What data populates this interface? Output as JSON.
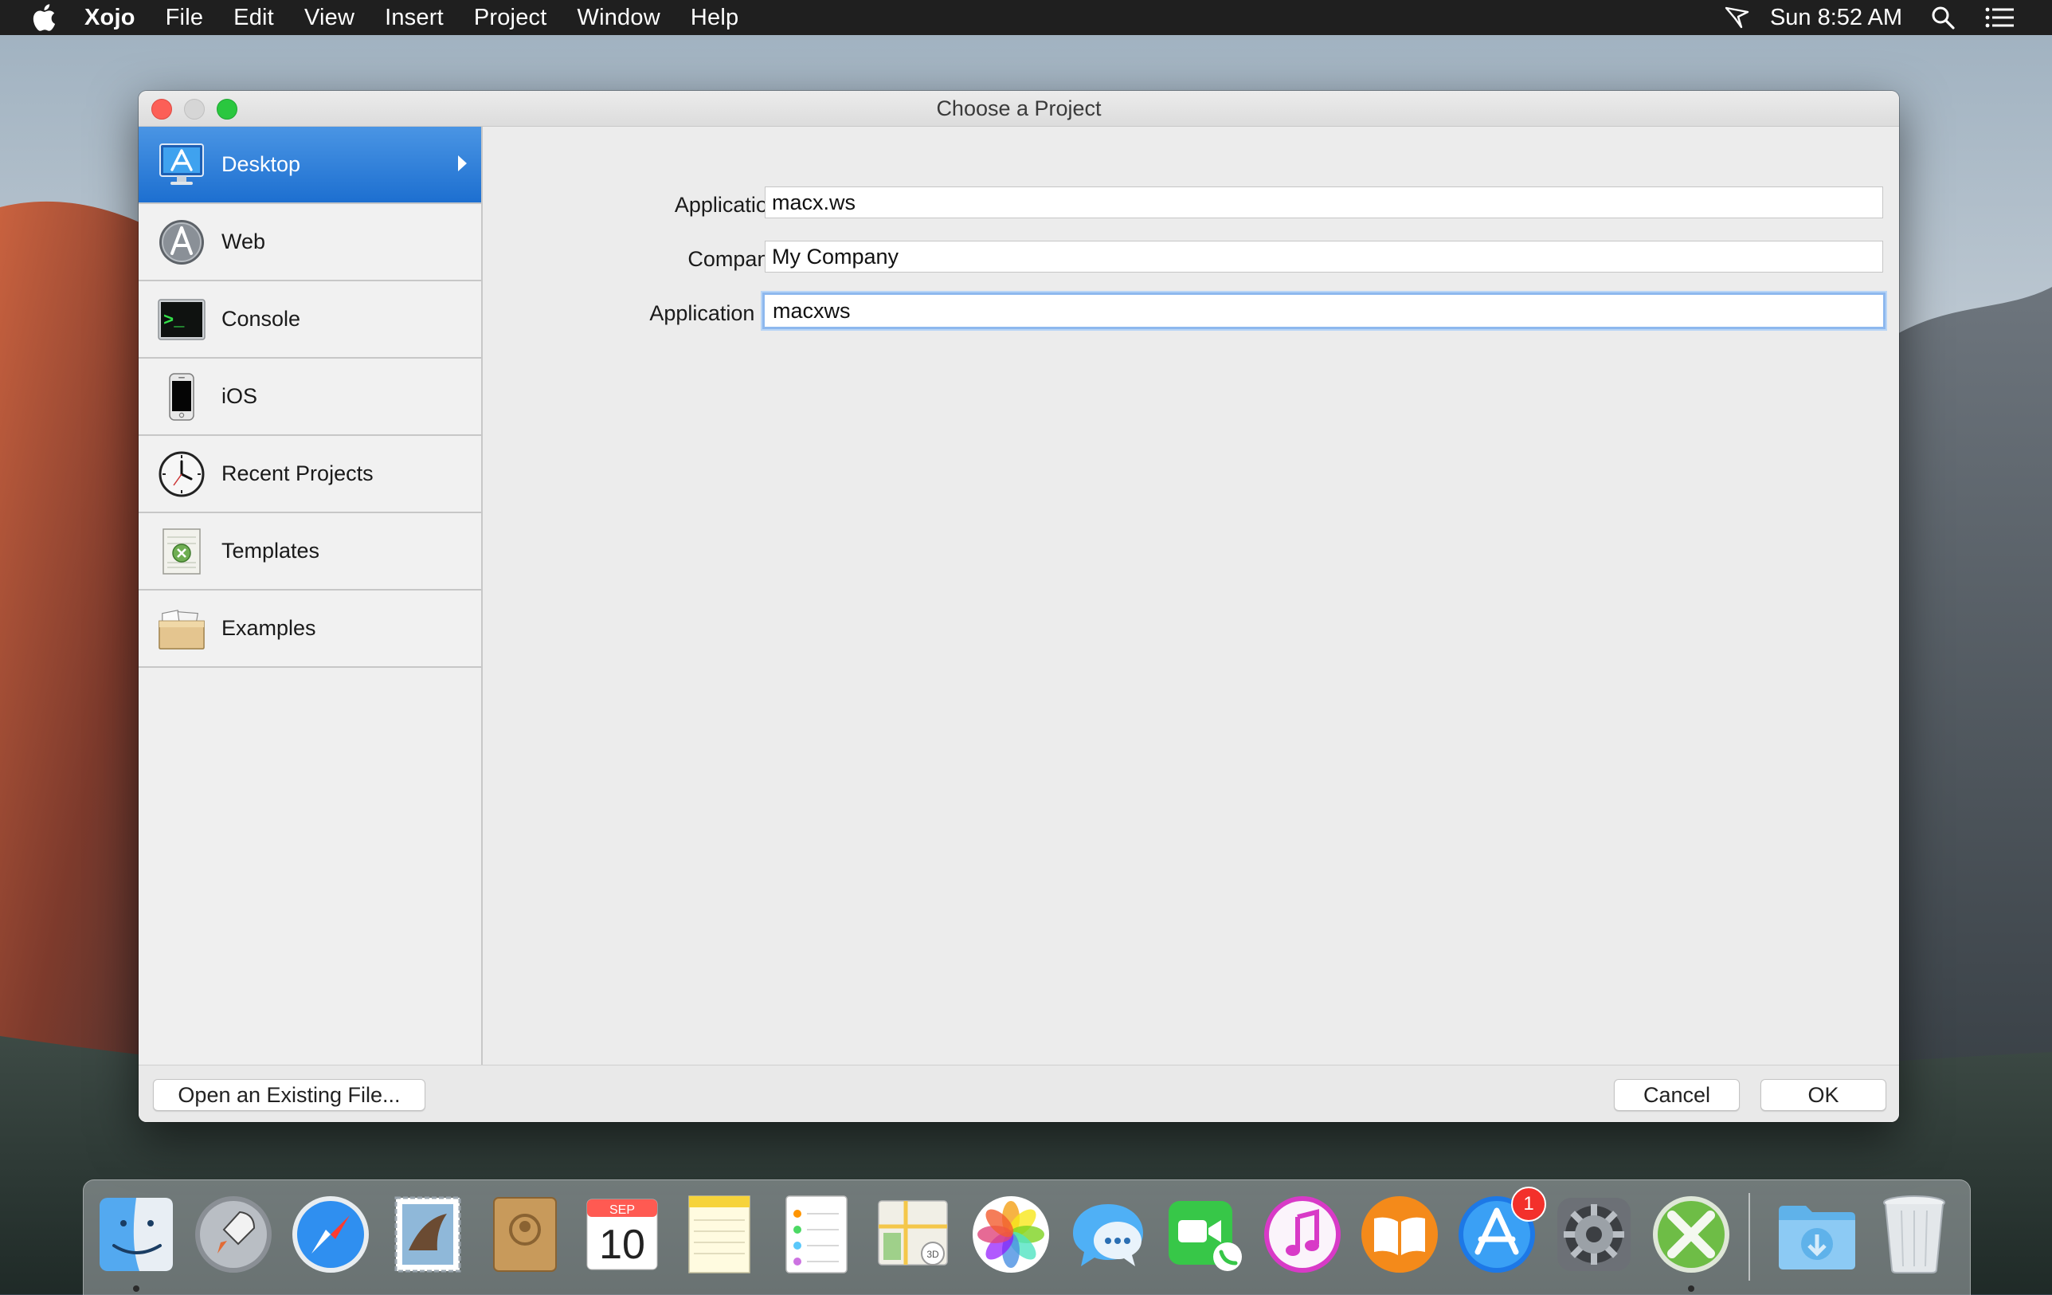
{
  "menubar": {
    "app_name": "Xojo",
    "items": [
      "File",
      "Edit",
      "View",
      "Insert",
      "Project",
      "Window",
      "Help"
    ],
    "clock": "Sun 8:52 AM"
  },
  "window": {
    "title": "Choose a Project",
    "sidebar": [
      {
        "label": "Desktop",
        "icon": "desktop-app-icon",
        "selected": true
      },
      {
        "label": "Web",
        "icon": "web-app-icon",
        "selected": false
      },
      {
        "label": "Console",
        "icon": "console-terminal-icon",
        "selected": false
      },
      {
        "label": "iOS",
        "icon": "iphone-icon",
        "selected": false
      },
      {
        "label": "Recent Projects",
        "icon": "clock-icon",
        "selected": false
      },
      {
        "label": "Templates",
        "icon": "template-document-icon",
        "selected": false
      },
      {
        "label": "Examples",
        "icon": "folder-box-icon",
        "selected": false
      }
    ],
    "form": {
      "app_name_label": "Application Name:",
      "app_name_value": "macx.ws",
      "company_label": "Company Name:",
      "company_value": "My Company",
      "identifier_label": "Application Identifier:",
      "identifier_value": "macxws"
    },
    "buttons": {
      "open_existing": "Open an Existing File...",
      "cancel": "Cancel",
      "ok": "OK"
    }
  },
  "dock": {
    "items": [
      {
        "name": "finder-icon",
        "running": true
      },
      {
        "name": "launchpad-icon",
        "running": false
      },
      {
        "name": "safari-icon",
        "running": false
      },
      {
        "name": "mail-icon",
        "running": false
      },
      {
        "name": "contacts-icon",
        "running": false
      },
      {
        "name": "calendar-icon",
        "running": false,
        "month": "SEP",
        "day": "10"
      },
      {
        "name": "notes-icon",
        "running": false
      },
      {
        "name": "reminders-icon",
        "running": false
      },
      {
        "name": "maps-icon",
        "running": false
      },
      {
        "name": "photos-icon",
        "running": false
      },
      {
        "name": "messages-icon",
        "running": false
      },
      {
        "name": "facetime-icon",
        "running": false
      },
      {
        "name": "itunes-icon",
        "running": false
      },
      {
        "name": "ibooks-icon",
        "running": false
      },
      {
        "name": "app-store-icon",
        "running": false,
        "badge": "1"
      },
      {
        "name": "system-preferences-icon",
        "running": false
      },
      {
        "name": "xojo-icon",
        "running": true
      },
      {
        "name": "downloads-folder-icon",
        "running": false
      },
      {
        "name": "trash-icon",
        "running": false
      }
    ]
  },
  "colors": {
    "selection_blue": "#2a7bd8",
    "menubar": "#1f1f1f",
    "window_bg": "#ececec",
    "focus_ring": "#8db8ee"
  }
}
